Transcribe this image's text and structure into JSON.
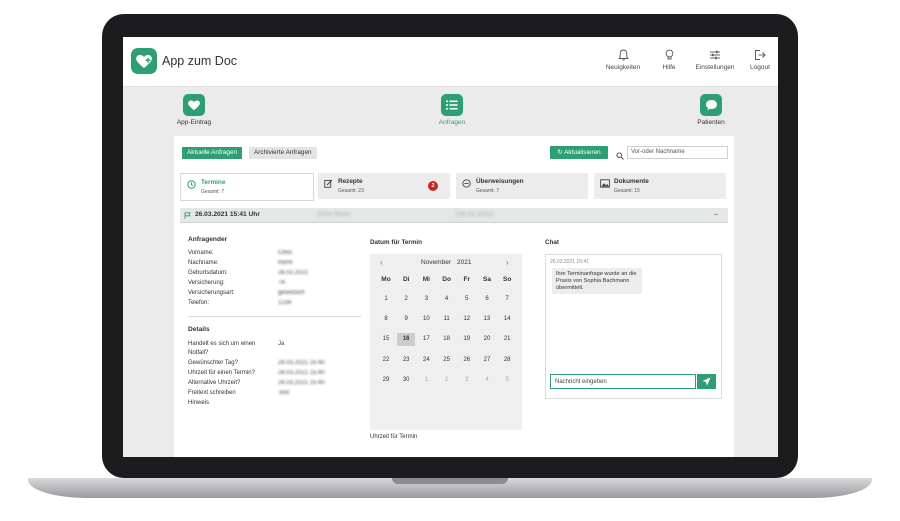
{
  "app": {
    "title": "App zum Doc"
  },
  "topnav": [
    {
      "label": "Neuigkeiten",
      "icon": "bell-icon"
    },
    {
      "label": "Hilfe",
      "icon": "lightbulb-icon"
    },
    {
      "label": "Einstellungen",
      "icon": "sliders-icon"
    },
    {
      "label": "Logout",
      "icon": "logout-icon"
    }
  ],
  "mainnav": [
    {
      "label": "App-Eintrag",
      "icon": "heart-plus-icon"
    },
    {
      "label": "Anfragen",
      "icon": "list-icon",
      "active": true
    },
    {
      "label": "Patienten",
      "icon": "chat-bubble-icon"
    }
  ],
  "tabs": {
    "current": "Aktuelle Anfragen",
    "archived": "Archivierte Anfragen"
  },
  "toolbar": {
    "refresh": "Aktualisieren",
    "search_placeholder": "Vor-oder Nachname"
  },
  "categories": [
    {
      "title": "Termine",
      "sub": "Gesamt: 7",
      "icon": "clock-icon",
      "active": true
    },
    {
      "title": "Rezepte",
      "sub": "Gesamt: 23",
      "icon": "pen-icon",
      "badge": "2"
    },
    {
      "title": "Überweisungen",
      "sub": "Gesamt: 7",
      "icon": "arrow-circle-icon"
    },
    {
      "title": "Dokumente",
      "sub": "Gesamt: 15",
      "icon": "image-icon"
    }
  ],
  "request": {
    "datetime": "26.03.2021 15:41 Uhr",
    "name": "Chris Remf",
    "date": "(26.03.2021)",
    "collapse": "–"
  },
  "requester": {
    "title": "Anfragender",
    "fields": [
      {
        "label": "Vorname:",
        "value": "Chris"
      },
      {
        "label": "Nachname:",
        "value": "Remf"
      },
      {
        "label": "Geburtsdatum:",
        "value": "26.03.2021"
      },
      {
        "label": "Versicherung:",
        "value": "TK"
      },
      {
        "label": "Versicherungsart:",
        "value": "gesetzlich"
      },
      {
        "label": "Telefon:",
        "value": "1234"
      }
    ]
  },
  "details": {
    "title": "Details",
    "fields": [
      {
        "label": "Handelt es sich um einen",
        "value": "Ja"
      },
      {
        "label": "Notfall?",
        "value": ""
      },
      {
        "label": "Gewünschter Tag?",
        "value": "26.03.2021 15:40"
      },
      {
        "label": "Uhrzeit für einen Termin?",
        "value": "26.03.2021 15:40"
      },
      {
        "label": "Alternative Uhrzeit?",
        "value": "26.03.2021 15:40"
      },
      {
        "label": "Freitext schreiben",
        "value": "Test"
      },
      {
        "label": "Hinweis",
        "value": ""
      }
    ]
  },
  "calendar": {
    "title": "Datum für Termin",
    "month": "November",
    "year": "2021",
    "weekdays": [
      "Mo",
      "Di",
      "Mi",
      "Do",
      "Fr",
      "Sa",
      "So"
    ],
    "selected": 16,
    "days": [
      [
        1,
        2,
        3,
        4,
        5,
        6,
        7
      ],
      [
        8,
        9,
        10,
        11,
        12,
        13,
        14
      ],
      [
        15,
        16,
        17,
        18,
        19,
        20,
        21
      ],
      [
        22,
        23,
        24,
        25,
        26,
        27,
        28
      ],
      [
        29,
        30,
        1,
        2,
        3,
        4,
        5
      ]
    ],
    "time_label": "Uhrzeit für Termin"
  },
  "chat": {
    "title": "Chat",
    "timestamp": "26.03.2021 15:41",
    "message": "Ihre Terminanfrage wurde an die Praxis von Sophia Bachmann übermittelt.",
    "input_placeholder": "Nachricht eingeben"
  },
  "colors": {
    "brand": "#2e9e73",
    "badge": "#c62828"
  }
}
